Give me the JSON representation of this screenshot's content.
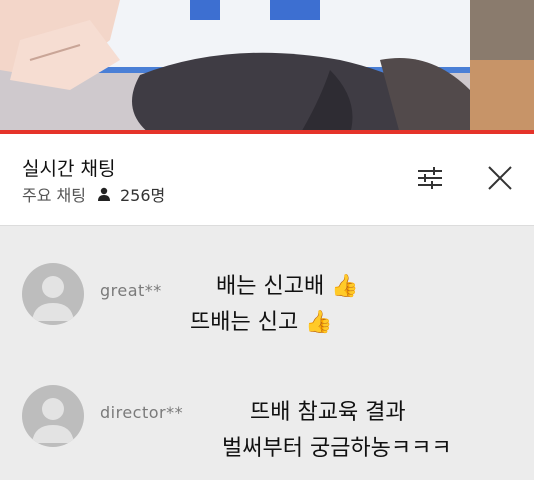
{
  "header": {
    "title": "실시간 채팅",
    "sub_label": "주요 채팅",
    "viewer_count": "256명"
  },
  "icons": {
    "viewers": "person-icon",
    "settings": "sliders-icon",
    "close": "close-icon"
  },
  "colors": {
    "accent": "#e5332a",
    "background": "#ececec"
  },
  "messages": [
    {
      "user": "great**",
      "lines": [
        "배는 신고배 👍",
        "뜨배는 신고 👍"
      ]
    },
    {
      "user": "director**",
      "lines": [
        "뜨배 참교육 결과",
        "벌써부터 궁금하농ㅋㅋㅋ"
      ]
    }
  ]
}
